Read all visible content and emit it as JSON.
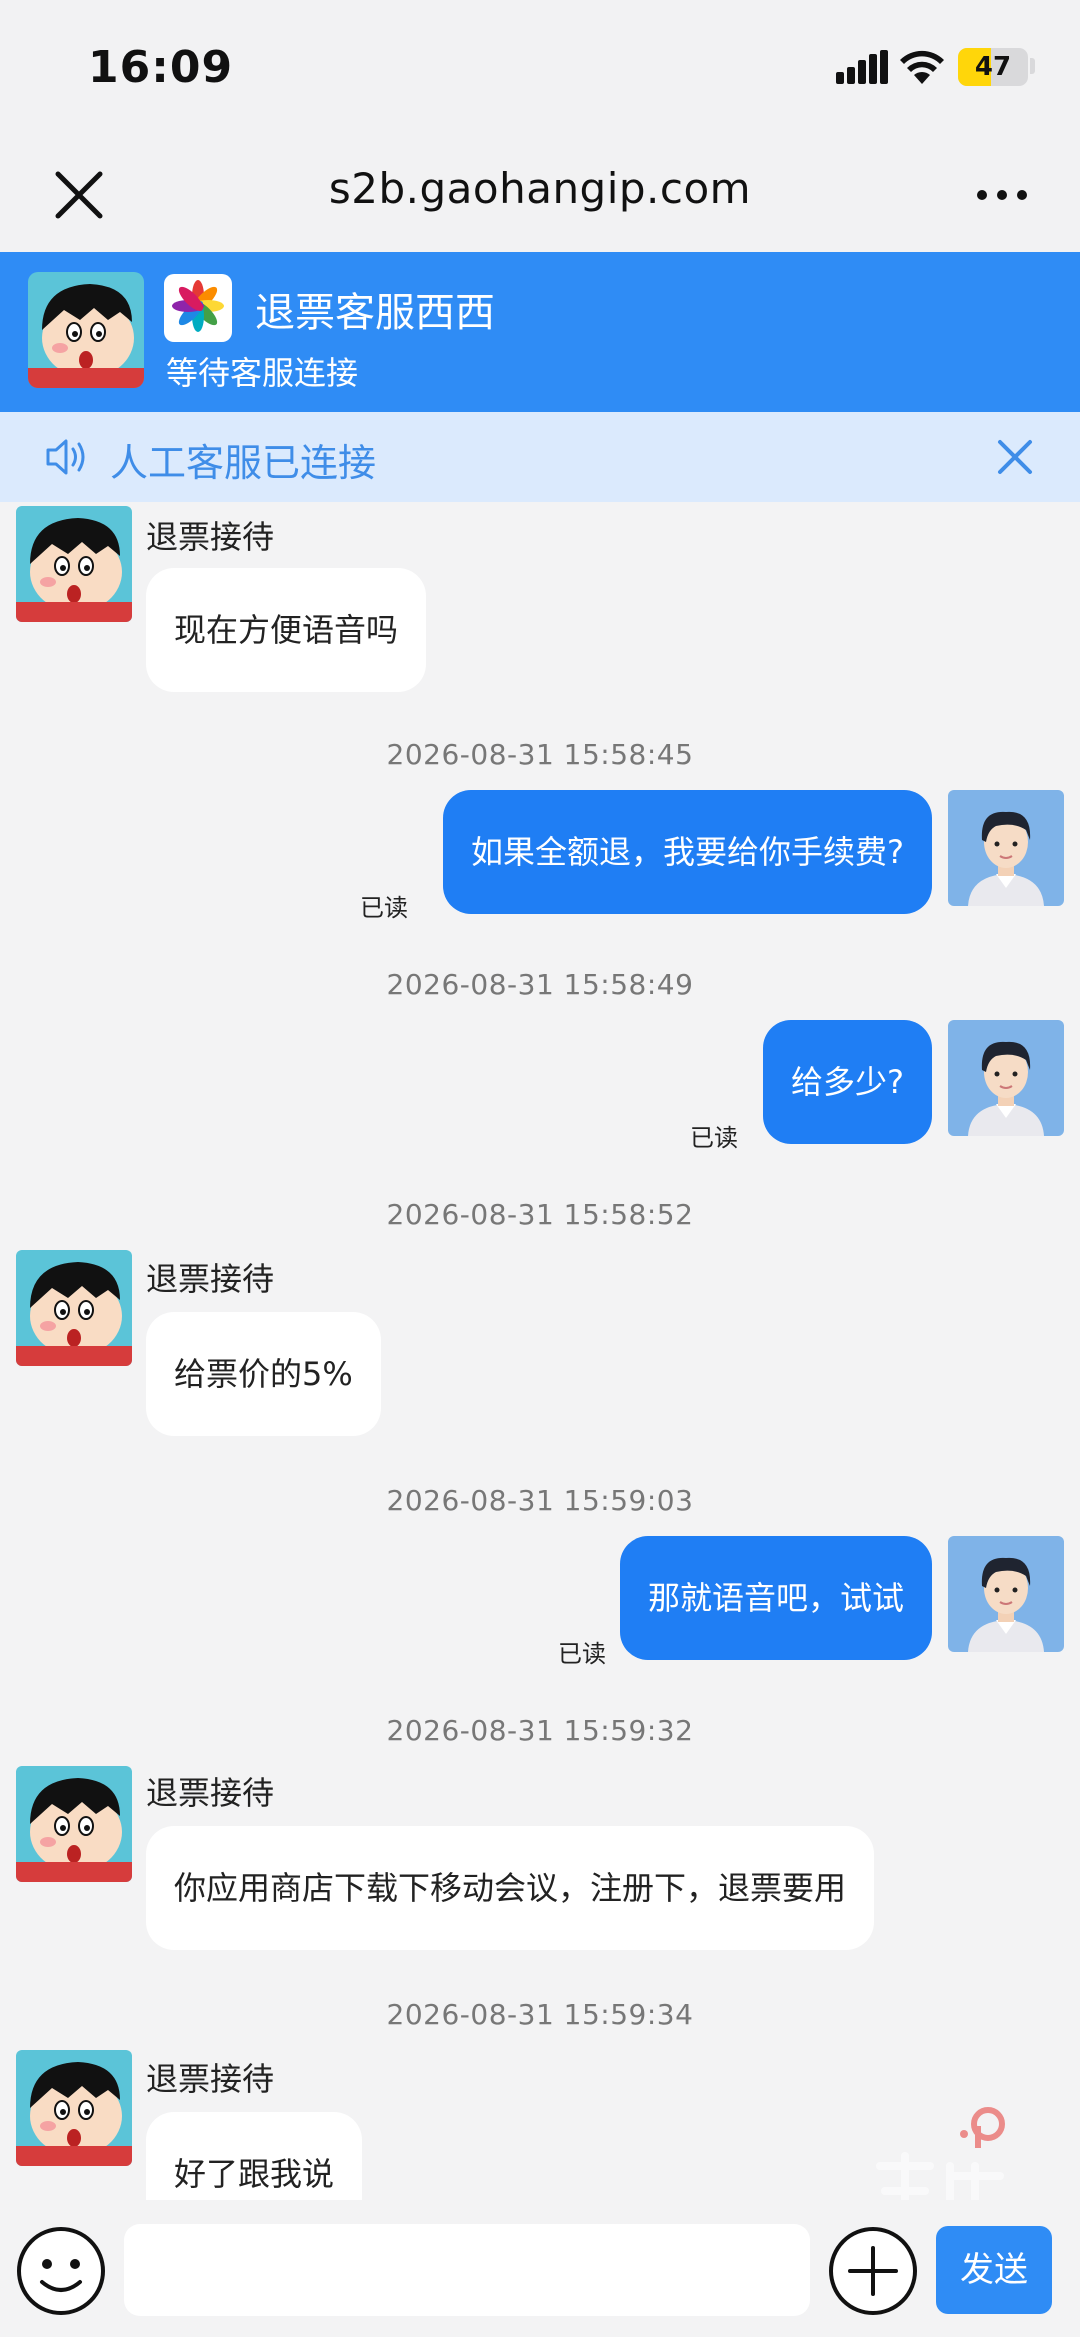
{
  "status_bar": {
    "time": "16:09",
    "battery": "47",
    "battery_level": 0.47
  },
  "browser": {
    "url": "s2b.gaohangip.com"
  },
  "header": {
    "title": "退票客服西西",
    "subtitle": "等待客服连接"
  },
  "notice": {
    "text": "人工客服已连接"
  },
  "messages": [
    {
      "side": "in",
      "sender": "退票接待",
      "text": "现在方便语音吗"
    },
    {
      "side": "time",
      "text": "2026-08-31 15:58:45"
    },
    {
      "side": "out",
      "text": "如果全额退，我要给你手续费?",
      "status": "已读"
    },
    {
      "side": "time",
      "text": "2026-08-31 15:58:49"
    },
    {
      "side": "out",
      "text": "给多少?",
      "status": "已读"
    },
    {
      "side": "time",
      "text": "2026-08-31 15:58:52"
    },
    {
      "side": "in",
      "sender": "退票接待",
      "text": "给票价的5%"
    },
    {
      "side": "time",
      "text": "2026-08-31 15:59:03"
    },
    {
      "side": "out",
      "text": "那就语音吧，试试",
      "status": "已读"
    },
    {
      "side": "time",
      "text": "2026-08-31 15:59:32"
    },
    {
      "side": "in",
      "sender": "退票接待",
      "text": "你应用商店下载下移动会议，注册下，退票要用"
    },
    {
      "side": "time",
      "text": "2026-08-31 15:59:34"
    },
    {
      "side": "in",
      "sender": "退票接待",
      "text": "好了跟我说"
    }
  ],
  "input": {
    "placeholder": "",
    "send_label": "发送"
  },
  "colors": {
    "primary": "#2f8cf5",
    "outgoing_bubble": "#1f7ef4",
    "notice_bg": "#dbeafd",
    "notice_text": "#3f8de8"
  }
}
